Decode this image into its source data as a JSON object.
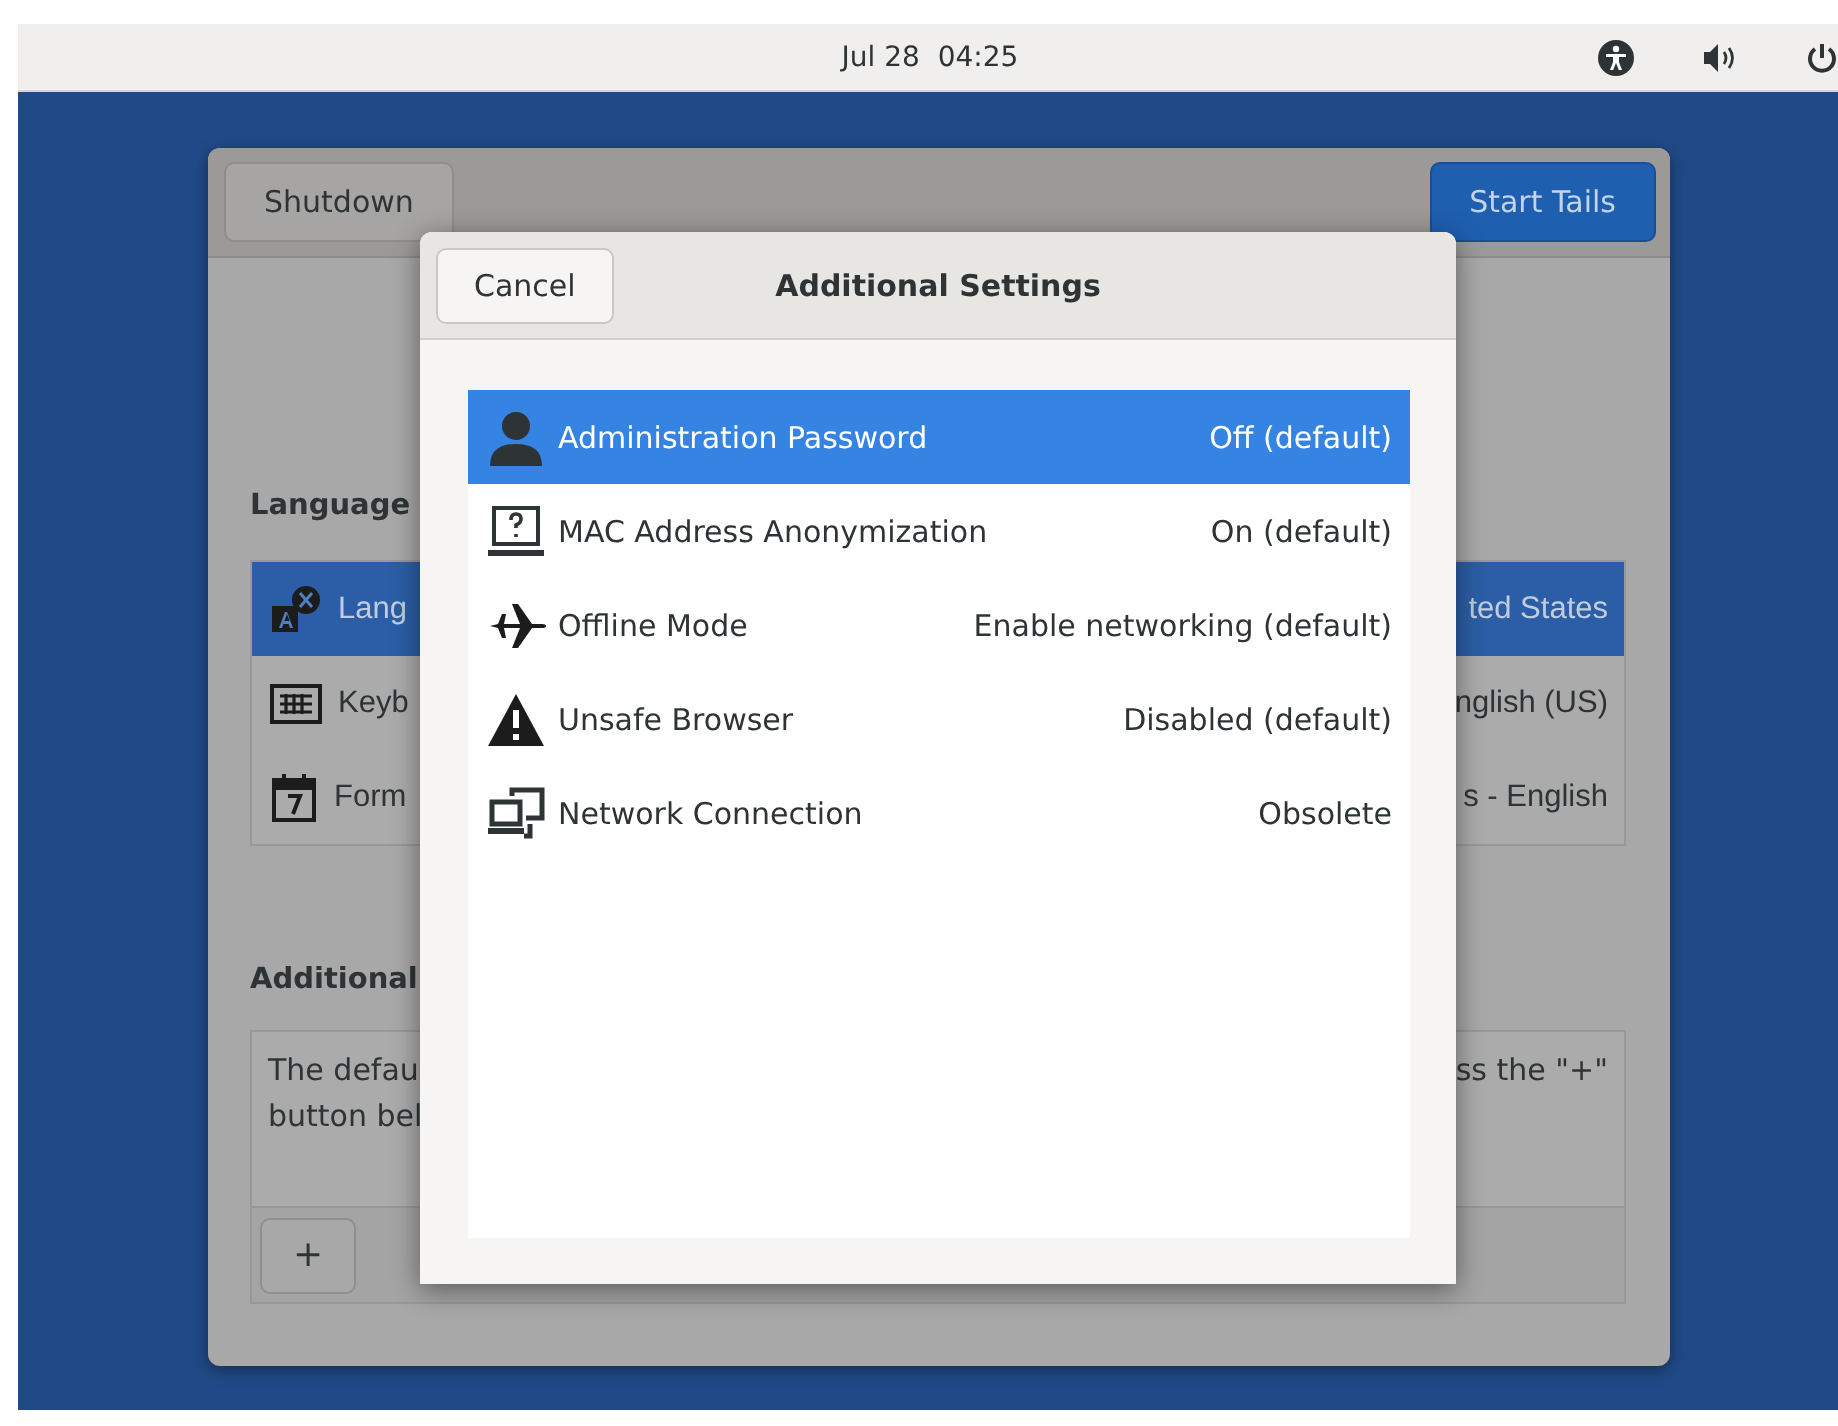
{
  "top_bar": {
    "clock": "Jul 28  04:25"
  },
  "main_window": {
    "header_buttons": [
      {
        "label": "Shutdown",
        "kind": "plain"
      },
      {
        "label": "Start Tails",
        "kind": "suggested"
      }
    ],
    "language_section": {
      "heading": "Language",
      "rows": [
        {
          "label": "Lang",
          "value": "ted States",
          "selected": true
        },
        {
          "label": "Keyb",
          "value": "nglish (US)",
          "selected": false
        },
        {
          "label": "Form",
          "value": "s - English",
          "selected": false
        }
      ]
    },
    "additional_section": {
      "heading": "Additional",
      "text_lines": [
        {
          "left": "The defau",
          "right": "ss the \"+\""
        },
        {
          "left": "button bel"
        }
      ],
      "add_button": "+"
    }
  },
  "dialog": {
    "cancel": "Cancel",
    "title": "Additional Settings",
    "settings": [
      {
        "name": "Administration Password",
        "value": "Off (default)",
        "selected": true
      },
      {
        "name": "MAC Address Anonymization",
        "value": "On (default)",
        "selected": false
      },
      {
        "name": "Offline Mode",
        "value": "Enable networking (default)",
        "selected": false
      },
      {
        "name": "Unsafe Browser",
        "value": "Disabled (default)",
        "selected": false
      },
      {
        "name": "Network Connection",
        "value": "Obsolete",
        "selected": false
      }
    ]
  }
}
